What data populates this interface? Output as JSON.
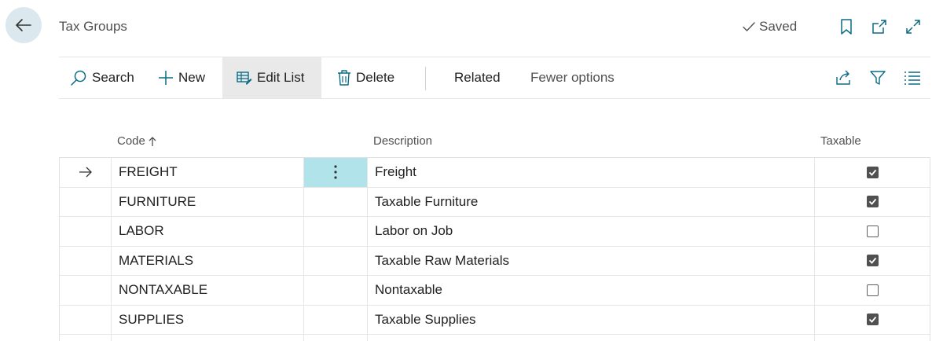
{
  "header": {
    "title": "Tax Groups",
    "saved_label": "Saved",
    "icons": [
      "back-arrow-icon",
      "bookmark-icon",
      "open-new-window-icon",
      "expand-icon"
    ]
  },
  "actions": {
    "search": "Search",
    "new": "New",
    "edit_list": "Edit List",
    "delete": "Delete",
    "related": "Related",
    "fewer_options": "Fewer options"
  },
  "columns": {
    "code": "Code",
    "description": "Description",
    "taxable": "Taxable"
  },
  "rows": [
    {
      "code": "FREIGHT",
      "description": "Freight",
      "taxable": true,
      "selected": true
    },
    {
      "code": "FURNITURE",
      "description": "Taxable Furniture",
      "taxable": true
    },
    {
      "code": "LABOR",
      "description": "Labor on Job",
      "taxable": false
    },
    {
      "code": "MATERIALS",
      "description": "Taxable Raw Materials",
      "taxable": true
    },
    {
      "code": "NONTAXABLE",
      "description": "Nontaxable",
      "taxable": false
    },
    {
      "code": "SUPPLIES",
      "description": "Taxable Supplies",
      "taxable": true
    }
  ],
  "colors": {
    "accent": "#0b6a86",
    "active_cell": "#b0e4ea",
    "back_button_bg": "#dbe9ef"
  }
}
